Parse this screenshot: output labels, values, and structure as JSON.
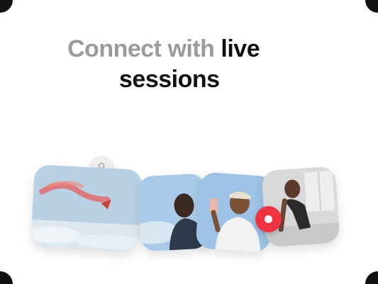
{
  "headline": {
    "part1": "Connect with",
    "part2": "live",
    "line2": "sessions"
  },
  "colors": {
    "headline_gray": "#9b9b9b",
    "headline_dark": "#111111",
    "record_red": "#ef3341"
  },
  "icons": {
    "avatar": "person-icon",
    "record": "record-dot-icon"
  },
  "cards": [
    {
      "subject": "red kite in sky"
    },
    {
      "subject": "person looking up at sky"
    },
    {
      "subject": "person taking selfie"
    },
    {
      "subject": "yoga pose indoors"
    }
  ]
}
